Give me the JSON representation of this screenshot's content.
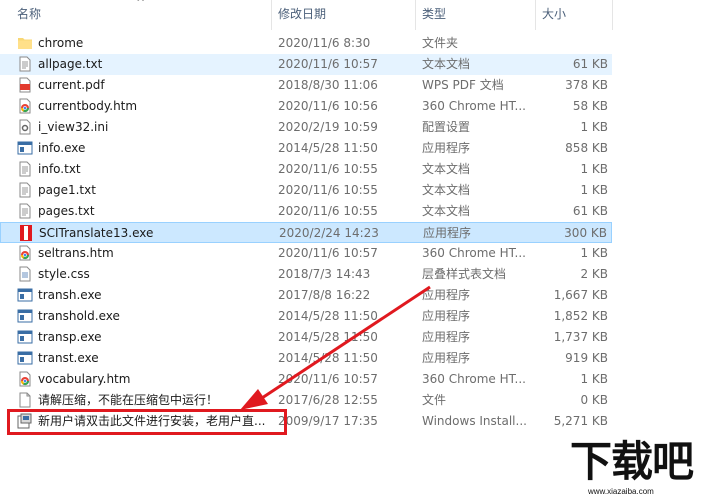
{
  "header": {
    "name_col": "名称",
    "date_col": "修改日期",
    "type_col": "类型",
    "size_col": "大小"
  },
  "files": [
    {
      "name": "chrome",
      "date": "2020/11/6 8:30",
      "type": "文件夹",
      "size": "",
      "icon": "folder-icon"
    },
    {
      "name": "allpage.txt",
      "date": "2020/11/6 10:57",
      "type": "文本文档",
      "size": "61 KB",
      "icon": "text-file-icon"
    },
    {
      "name": "current.pdf",
      "date": "2018/8/30 11:06",
      "type": "WPS PDF 文档",
      "size": "378 KB",
      "icon": "pdf-file-icon"
    },
    {
      "name": "currentbody.htm",
      "date": "2020/11/6 10:56",
      "type": "360 Chrome HT...",
      "size": "58 KB",
      "icon": "chrome-html-icon"
    },
    {
      "name": "i_view32.ini",
      "date": "2020/2/19 10:59",
      "type": "配置设置",
      "size": "1 KB",
      "icon": "ini-file-icon"
    },
    {
      "name": "info.exe",
      "date": "2014/5/28 11:50",
      "type": "应用程序",
      "size": "858 KB",
      "icon": "exe-icon"
    },
    {
      "name": "info.txt",
      "date": "2020/11/6 10:55",
      "type": "文本文档",
      "size": "1 KB",
      "icon": "text-file-icon"
    },
    {
      "name": "page1.txt",
      "date": "2020/11/6 10:55",
      "type": "文本文档",
      "size": "1 KB",
      "icon": "text-file-icon"
    },
    {
      "name": "pages.txt",
      "date": "2020/11/6 10:55",
      "type": "文本文档",
      "size": "61 KB",
      "icon": "text-file-icon"
    },
    {
      "name": "SCITranslate13.exe",
      "date": "2020/2/24 14:23",
      "type": "应用程序",
      "size": "300 KB",
      "icon": "scitranslate-app-icon"
    },
    {
      "name": "seltrans.htm",
      "date": "2020/11/6 10:57",
      "type": "360 Chrome HT...",
      "size": "1 KB",
      "icon": "chrome-html-icon"
    },
    {
      "name": "style.css",
      "date": "2018/7/3 14:43",
      "type": "层叠样式表文档",
      "size": "2 KB",
      "icon": "css-file-icon"
    },
    {
      "name": "transh.exe",
      "date": "2017/8/8 16:22",
      "type": "应用程序",
      "size": "1,667 KB",
      "icon": "exe-icon"
    },
    {
      "name": "transhold.exe",
      "date": "2014/5/28 11:50",
      "type": "应用程序",
      "size": "1,852 KB",
      "icon": "exe-icon"
    },
    {
      "name": "transp.exe",
      "date": "2014/5/28 11:50",
      "type": "应用程序",
      "size": "1,737 KB",
      "icon": "exe-icon"
    },
    {
      "name": "transt.exe",
      "date": "2014/5/28 11:50",
      "type": "应用程序",
      "size": "919 KB",
      "icon": "exe-icon"
    },
    {
      "name": "vocabulary.htm",
      "date": "2020/11/6 10:57",
      "type": "360 Chrome HT...",
      "size": "1 KB",
      "icon": "chrome-html-icon"
    },
    {
      "name": "请解压缩，不能在压缩包中运行！",
      "date": "2017/6/28 12:55",
      "type": "文件",
      "size": "0 KB",
      "icon": "blank-file-icon"
    },
    {
      "name": "新用户请双击此文件进行安装，老用户直...",
      "date": "2009/9/17 17:35",
      "type": "Windows Install...",
      "size": "5,271 KB",
      "icon": "msi-installer-icon"
    }
  ],
  "selected_index": 9,
  "hover_index": 1,
  "watermark": {
    "logo_text": "下载吧",
    "url": "www.xiazaiba.com"
  },
  "colors": {
    "selection": "#cce8ff",
    "hover": "#e5f3ff",
    "highlight_red": "#e0191f"
  }
}
